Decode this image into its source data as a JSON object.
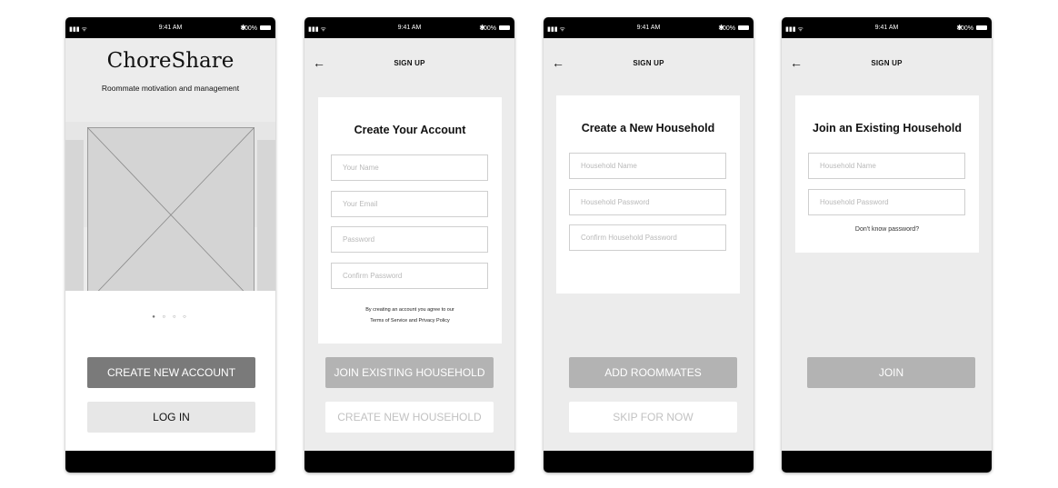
{
  "statusbar": {
    "time": "9:41 AM",
    "battery": "100%"
  },
  "screen1": {
    "brand": "ChoreShare",
    "tagline": "Roommate motivation and management",
    "create_button": "CREATE NEW ACCOUNT",
    "login_button": "LOG IN"
  },
  "screen2": {
    "header": "SIGN UP",
    "title": "Create Your Account",
    "fields": [
      "Your Name",
      "Your Email",
      "Password",
      "Confirm Password"
    ],
    "terms_line1": "By creating an account you agree to our",
    "terms_line2": "Terms of Service and Privacy Policy",
    "join_button": "JOIN EXISTING HOUSEHOLD",
    "create_button": "CREATE NEW HOUSEHOLD"
  },
  "screen3": {
    "header": "SIGN UP",
    "title": "Create a New Household",
    "fields": [
      "Household Name",
      "Household Password",
      "Confirm Household Password"
    ],
    "add_button": "ADD ROOMMATES",
    "skip_button": "SKIP FOR NOW"
  },
  "screen4": {
    "header": "SIGN UP",
    "title": "Join an Existing Household",
    "fields": [
      "Household Name",
      "Household Password"
    ],
    "forgot_link": "Don't know password?",
    "join_button": "JOIN"
  }
}
